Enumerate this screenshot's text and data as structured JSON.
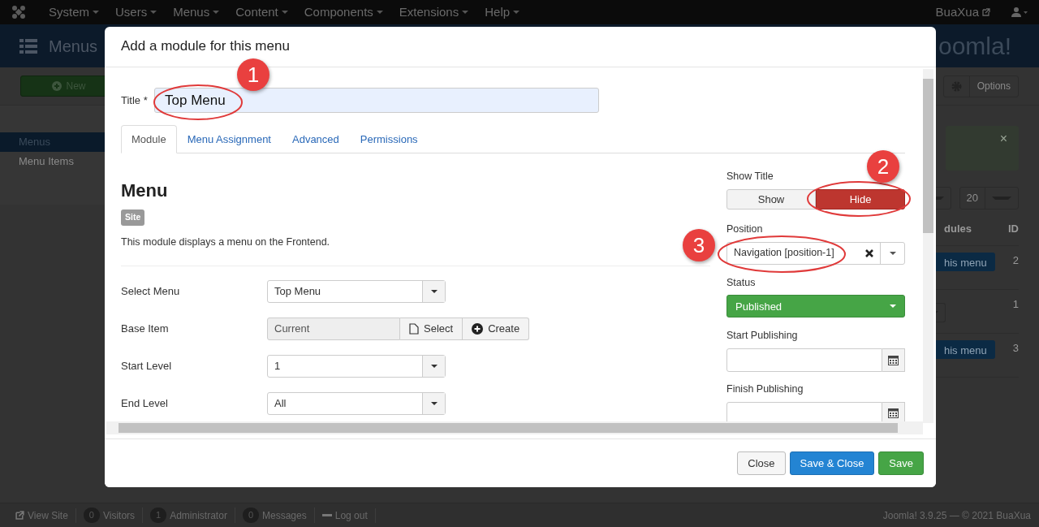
{
  "top_nav": {
    "items": [
      {
        "label": "System"
      },
      {
        "label": "Users"
      },
      {
        "label": "Menus"
      },
      {
        "label": "Content"
      },
      {
        "label": "Components"
      },
      {
        "label": "Extensions"
      },
      {
        "label": "Help"
      }
    ],
    "user": "BuaXua"
  },
  "header": {
    "title": "Menus",
    "logo": "oomla!"
  },
  "toolbar": {
    "new": "New",
    "options": "Options"
  },
  "sidebar": {
    "items": [
      {
        "label": "Menus",
        "selected": true
      },
      {
        "label": "Menu Items",
        "selected": false
      }
    ]
  },
  "list_partial": {
    "alert_close": "×",
    "limit": "20",
    "columns": [
      "dules",
      "ID"
    ],
    "rows": [
      {
        "kind": "button",
        "label": "his menu",
        "id": "2"
      },
      {
        "kind": "dropdown",
        "id": "1"
      },
      {
        "kind": "button",
        "label": "his menu",
        "id": "3"
      }
    ]
  },
  "status_bar": {
    "items": [
      {
        "kind": "link",
        "label": "View Site"
      },
      {
        "kind": "count",
        "count": "0",
        "label": "Visitors"
      },
      {
        "kind": "count",
        "count": "1",
        "label": "Administrator"
      },
      {
        "kind": "count",
        "count": "0",
        "label": "Messages"
      },
      {
        "kind": "logout",
        "label": "Log out"
      }
    ],
    "copyright": "Joomla! 3.9.25 — © 2021 BuaXua"
  },
  "modal": {
    "title": "Add a module for this menu",
    "title_field": {
      "label": "Title *",
      "value": "Top Menu"
    },
    "tabs": [
      {
        "label": "Module",
        "selected": true
      },
      {
        "label": "Menu Assignment",
        "selected": false
      },
      {
        "label": "Advanced",
        "selected": false
      },
      {
        "label": "Permissions",
        "selected": false
      }
    ],
    "module": {
      "heading": "Menu",
      "badge": "Site",
      "description": "This module displays a menu on the Frontend.",
      "fields": [
        {
          "kind": "select",
          "label": "Select Menu",
          "value": "Top Menu"
        },
        {
          "kind": "picker",
          "label": "Base Item",
          "value": "Current",
          "buttons": [
            "Select",
            "Create"
          ]
        },
        {
          "kind": "select",
          "label": "Start Level",
          "value": "1"
        },
        {
          "kind": "select",
          "label": "End Level",
          "value": "All"
        }
      ]
    },
    "side": {
      "show_title": {
        "label": "Show Title",
        "options": [
          {
            "label": "Show",
            "selected": false
          },
          {
            "label": "Hide",
            "selected": true
          }
        ]
      },
      "position": {
        "label": "Position",
        "value": "Navigation [position-1]"
      },
      "status": {
        "label": "Status",
        "value": "Published"
      },
      "start_publishing": {
        "label": "Start Publishing"
      },
      "finish_publishing": {
        "label": "Finish Publishing"
      }
    },
    "buttons": [
      {
        "kind": "default",
        "label": "Close"
      },
      {
        "kind": "primary",
        "label": "Save & Close"
      },
      {
        "kind": "success",
        "label": "Save"
      }
    ]
  },
  "annotations": [
    {
      "number": "1"
    },
    {
      "number": "2"
    },
    {
      "number": "3"
    }
  ]
}
